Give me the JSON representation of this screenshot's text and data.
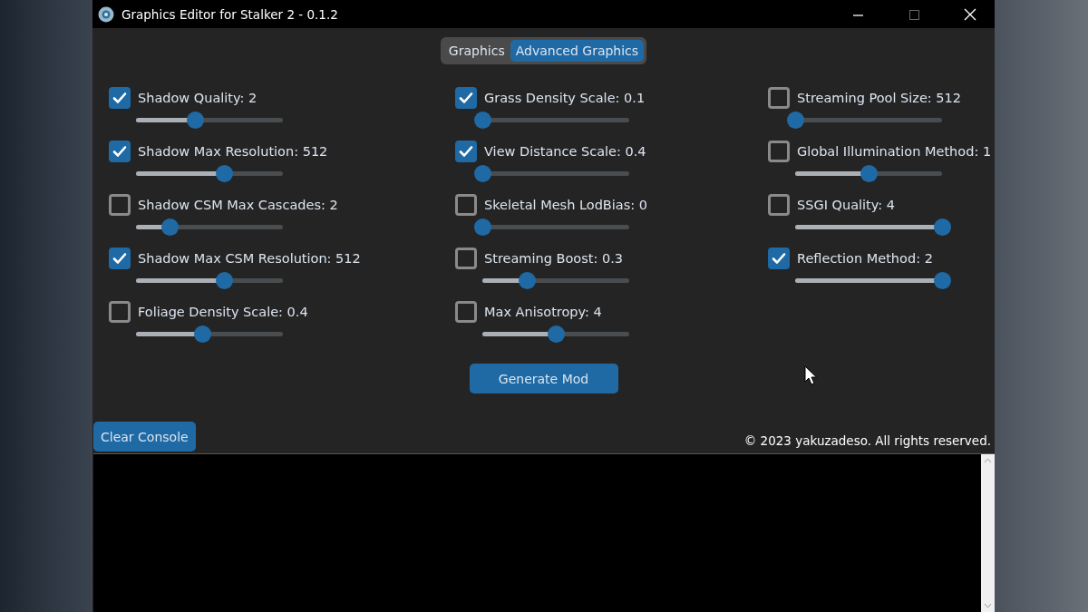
{
  "window": {
    "title": "Graphics Editor for Stalker 2 - 0.1.2"
  },
  "tabs": [
    {
      "label": "Graphics",
      "selected": false
    },
    {
      "label": "Advanced Graphics",
      "selected": true
    }
  ],
  "columns": [
    {
      "settings": [
        {
          "label": "Shadow Quality: 2",
          "checked": true,
          "level": 0.4
        },
        {
          "label": "Shadow Max Resolution: 512",
          "checked": true,
          "level": 0.6
        },
        {
          "label": "Shadow CSM Max Cascades: 2",
          "checked": false,
          "level": 0.23
        },
        {
          "label": "Shadow Max CSM Resolution: 512",
          "checked": true,
          "level": 0.6
        },
        {
          "label": "Foliage Density Scale: 0.4",
          "checked": false,
          "level": 0.45
        }
      ]
    },
    {
      "settings": [
        {
          "label": "Grass Density Scale: 0.1",
          "checked": true,
          "level": 0
        },
        {
          "label": "View Distance Scale: 0.4",
          "checked": true,
          "level": 0
        },
        {
          "label": "Skeletal Mesh LodBias: 0",
          "checked": false,
          "level": 0
        },
        {
          "label": "Streaming Boost: 0.3",
          "checked": false,
          "level": 0.3
        },
        {
          "label": "Max Anisotropy: 4",
          "checked": false,
          "level": 0.5
        }
      ]
    },
    {
      "settings": [
        {
          "label": "Streaming Pool Size: 512",
          "checked": false,
          "level": 0
        },
        {
          "label": "Global Illumination Method: 1",
          "checked": false,
          "level": 0.5
        },
        {
          "label": "SSGI Quality: 4",
          "checked": false,
          "level": 1
        },
        {
          "label": "Reflection Method: 2",
          "checked": true,
          "level": 1
        }
      ]
    }
  ],
  "generate_button": "Generate Mod",
  "clear_console_button": "Clear Console",
  "copyright": "© 2023 yakuzadeso. All rights reserved."
}
